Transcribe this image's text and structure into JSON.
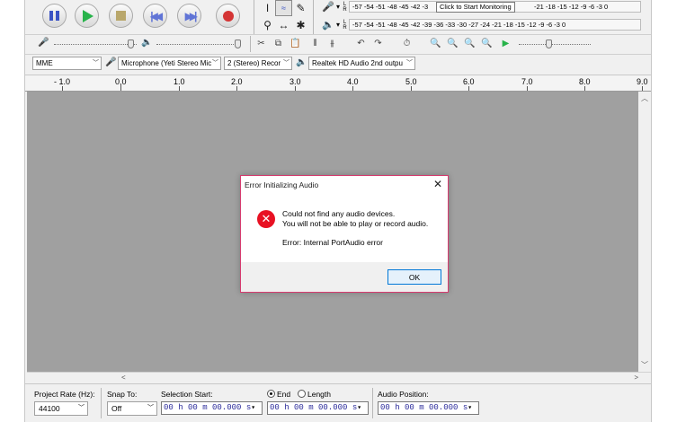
{
  "transport": {
    "pause_icon": "pause-icon",
    "play_icon": "play-icon",
    "stop_icon": "stop-icon",
    "skip_start_icon": "skip-to-start-icon",
    "skip_end_icon": "skip-to-end-icon",
    "record_icon": "record-icon"
  },
  "meters": {
    "record_scale": "-57 -54 -51 -48 -45 -42 -3",
    "record_scale_right": "-21 -18 -15 -12 -9 -6 -3 0",
    "monitor_tooltip": "Click to Start Monitoring",
    "playback_scale": "-57 -54 -51 -48 -45 -42 -39 -36 -33 -30 -27 -24 -21 -18 -15 -12 -9 -6 -3 0",
    "left": "L",
    "right": "R"
  },
  "device_bar": {
    "host": "MME",
    "recording_device": "Microphone (Yeti Stereo Mic",
    "channels": "2 (Stereo) Recor",
    "playback_device": "Realtek HD Audio 2nd outpu"
  },
  "ruler": {
    "labels": [
      "- 1.0",
      "0.0",
      "1.0",
      "2.0",
      "3.0",
      "4.0",
      "5.0",
      "6.0",
      "7.0",
      "8.0",
      "9.0"
    ]
  },
  "dialog": {
    "title": "Error Initializing Audio",
    "line1": "Could not find any audio devices.",
    "line2": "You will not be able to play or record audio.",
    "line3": "Error: Internal PortAudio error",
    "ok_label": "OK"
  },
  "selection_bar": {
    "project_rate_label": "Project Rate (Hz):",
    "project_rate_value": "44100",
    "snap_to_label": "Snap To:",
    "snap_to_value": "Off",
    "selection_start_label": "Selection Start:",
    "end_label": "End",
    "length_label": "Length",
    "audio_position_label": "Audio Position:",
    "time1": "00 h 00 m 00.000 s",
    "time2": "00 h 00 m 00.000 s",
    "time3": "00 h 00 m 00.000 s"
  },
  "colors": {
    "dialog_border": "#d63b6f",
    "error_red": "#e81123",
    "track_bg": "#a0a0a0",
    "time_digits": "#2a2a9a"
  }
}
